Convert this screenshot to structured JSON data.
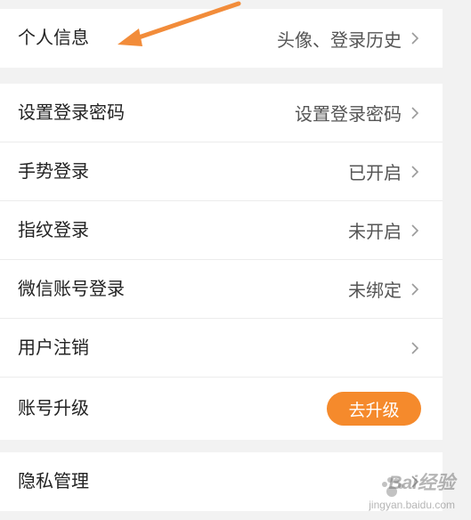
{
  "groups": [
    {
      "items": [
        {
          "label": "个人信息",
          "value": "头像、登录历史"
        }
      ]
    },
    {
      "items": [
        {
          "label": "设置登录密码",
          "value": "设置登录密码"
        },
        {
          "label": "手势登录",
          "value": "已开启"
        },
        {
          "label": "指纹登录",
          "value": "未开启"
        },
        {
          "label": "微信账号登录",
          "value": "未绑定"
        },
        {
          "label": "用户注销",
          "value": ""
        },
        {
          "label": "账号升级",
          "button": "去升级"
        }
      ]
    },
    {
      "items": [
        {
          "label": "隐私管理",
          "value": ""
        }
      ]
    }
  ],
  "watermark": {
    "text": "Bai经验",
    "sub": "jingyan.baidu.com"
  },
  "colors": {
    "accent": "#f58a2c",
    "annotation_arrow": "#f28c3a",
    "background": "#f2f2f2"
  },
  "icons": {
    "row_chevron": "chevron-right-icon",
    "annotation": "arrow-annotation-icon"
  }
}
